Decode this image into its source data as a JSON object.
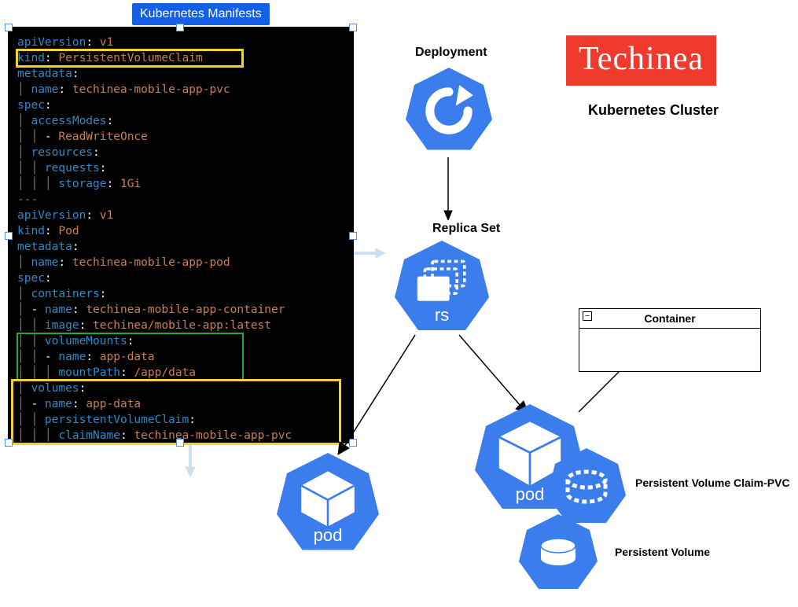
{
  "header": {
    "tab": "Kubernetes Manifests"
  },
  "brand": {
    "name": "Techinea"
  },
  "cluster_label": "Kubernetes Cluster",
  "labels": {
    "deployment": "Deployment",
    "replicaset": "Replica Set",
    "container": "Container",
    "pvc": "Persistent Volume Claim-PVC",
    "pv": "Persistent Volume",
    "rs_text": "rs",
    "pod_text": "pod"
  },
  "yaml": {
    "doc1": {
      "apiVersion": "apiVersion",
      "apiVersion_v": "v1",
      "kind": "kind",
      "kind_v": "PersistentVolumeClaim",
      "metadata": "metadata",
      "name": "name",
      "name_v": "techinea-mobile-app-pvc",
      "spec": "spec",
      "accessModes": "accessModes",
      "accessModes_v": "ReadWriteOnce",
      "resources": "resources",
      "requests": "requests",
      "storage": "storage",
      "storage_v": "1Gi"
    },
    "sep": "---",
    "doc2": {
      "apiVersion": "apiVersion",
      "apiVersion_v": "v1",
      "kind": "kind",
      "kind_v": "Pod",
      "metadata": "metadata",
      "name": "name",
      "name_v": "techinea-mobile-app-pod",
      "spec": "spec",
      "containers": "containers",
      "cname": "name",
      "cname_v": "techinea-mobile-app-container",
      "image": "image",
      "image_v": "techinea/mobile-app:latest",
      "volumeMounts": "volumeMounts",
      "vm_name": "name",
      "vm_name_v": "app-data",
      "mountPath": "mountPath",
      "mountPath_v": "/app/data",
      "volumes": "volumes",
      "vol_name": "name",
      "vol_name_v": "app-data",
      "pvc": "persistentVolumeClaim",
      "claimName": "claimName",
      "claimName_v": "techinea-mobile-app-pvc"
    }
  }
}
